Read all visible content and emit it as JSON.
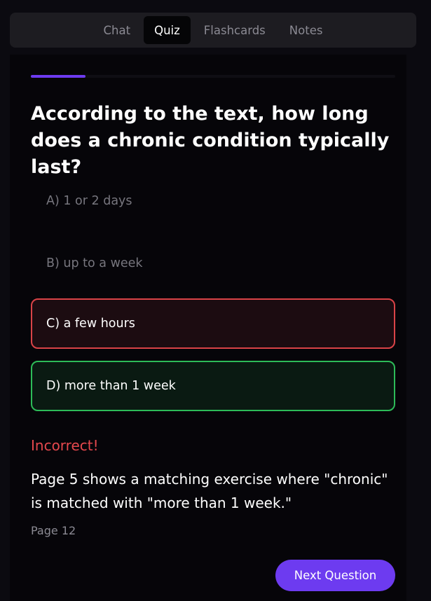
{
  "tabs": [
    {
      "label": "Chat",
      "active": false
    },
    {
      "label": "Quiz",
      "active": true
    },
    {
      "label": "Flashcards",
      "active": false
    },
    {
      "label": "Notes",
      "active": false
    }
  ],
  "quiz": {
    "progress_fraction": 0.15,
    "question": "According to the text, how long does a chronic condition typically last?",
    "options": [
      {
        "label": "A) 1 or 2 days",
        "state": "neutral"
      },
      {
        "label": "B) up to a week",
        "state": "neutral"
      },
      {
        "label": "C) a few hours",
        "state": "selected-wrong"
      },
      {
        "label": "D) more than 1 week",
        "state": "correct"
      }
    ],
    "result": "Incorrect!",
    "explanation": "Page 5 shows a matching exercise where \"chronic\" is matched with \"more than 1 week.\"",
    "page_reference": "Page 12",
    "next_button_label": "Next Question"
  },
  "colors": {
    "accent": "#6d3bf0",
    "wrong": "#d94347",
    "correct": "#2dbb58",
    "incorrect_text": "#e5484d"
  }
}
